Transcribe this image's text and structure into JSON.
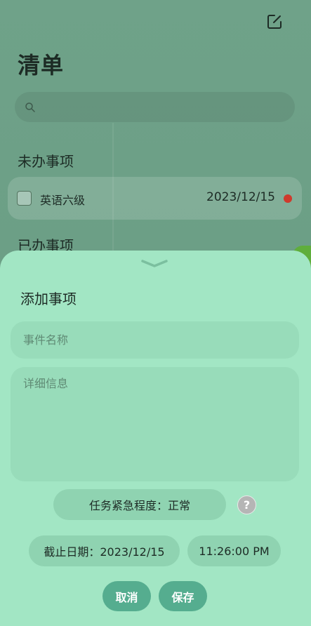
{
  "header": {
    "title": "清单",
    "edit_icon": "edit-square-icon"
  },
  "search": {
    "placeholder": "",
    "icon": "search-icon"
  },
  "sections": {
    "todo": {
      "title": "未办事项",
      "items": [
        {
          "name": "英语六级",
          "date": "2023/12/15",
          "priority_color": "#cf3a2c",
          "checked": false
        }
      ]
    },
    "done": {
      "title": "已办事项"
    }
  },
  "sheet": {
    "handle_icon": "chevron-down-icon",
    "title": "添加事项",
    "name_placeholder": "事件名称",
    "detail_placeholder": "详细信息",
    "urgency_label": "任务紧急程度：正常",
    "help_icon": "question-icon",
    "help_text": "?",
    "deadline_label": "截止日期：2023/12/15",
    "time_label": "11:26:00 PM",
    "cancel_label": "取消",
    "save_label": "保存"
  },
  "colors": {
    "background": "#6c9f86",
    "sheet": "#a2e6c4",
    "button": "#55ad8f",
    "priority_dot": "#cf3a2c"
  }
}
